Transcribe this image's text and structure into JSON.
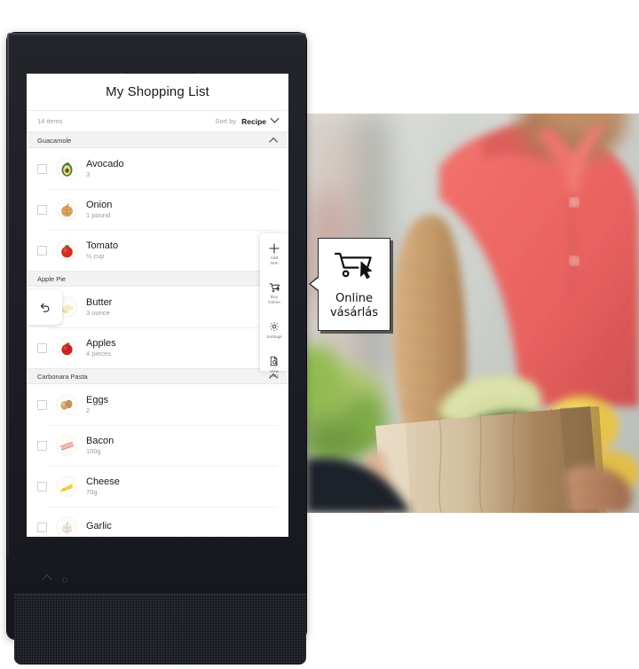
{
  "app": {
    "title": "My Shopping List",
    "item_count": "14 items",
    "sort_by_label": "Sort by",
    "sort_value": "Recipe",
    "sort_chevron_icon": "chevron-down-icon",
    "collapse_chevron_icon": "chevron-up-icon",
    "undo_icon": "undo-arrow-icon"
  },
  "groups": [
    {
      "name": "Guacamole",
      "items": [
        {
          "name": "Avocado",
          "qty": "3",
          "icon": "avocado-icon",
          "checked": false
        },
        {
          "name": "Onion",
          "qty": "1 pound",
          "icon": "onion-icon",
          "checked": false
        },
        {
          "name": "Tomato",
          "qty": "½ cup",
          "icon": "tomato-icon",
          "checked": false
        }
      ]
    },
    {
      "name": "Apple Pie",
      "items": [
        {
          "name": "Butter",
          "qty": "3 ounce",
          "icon": "butter-icon",
          "checked": false,
          "swiped": true
        },
        {
          "name": "Apples",
          "qty": "4 pieces",
          "icon": "apple-icon",
          "checked": false
        }
      ]
    },
    {
      "name": "Carbonara Pasta",
      "items": [
        {
          "name": "Eggs",
          "qty": "2",
          "icon": "eggs-icon",
          "checked": false
        },
        {
          "name": "Bacon",
          "qty": "100g",
          "icon": "bacon-icon",
          "checked": false
        },
        {
          "name": "Cheese",
          "qty": "70g",
          "icon": "cheese-icon",
          "checked": false
        },
        {
          "name": "Garlic",
          "qty": "",
          "icon": "garlic-icon",
          "checked": false
        }
      ]
    }
  ],
  "rail": [
    {
      "label": "Add\nItem",
      "icon": "plus-icon"
    },
    {
      "label": "Buy\nOnline",
      "icon": "shopping-cart-cursor-icon"
    },
    {
      "label": "Settings",
      "icon": "gear-icon"
    },
    {
      "label": "View\nLists",
      "icon": "document-search-icon"
    }
  ],
  "callout": {
    "text": "Online\nvásárlás",
    "icon": "cart-cursor-icon"
  },
  "photo": {
    "alt": "delivery-person-holding-grocery-bag"
  },
  "colors": {
    "device_body": "#1c1e24",
    "screen_bg": "#ffffff",
    "group_header_bg": "#f2f2f2",
    "shirt_red": "#e8625f",
    "bag_brown": "#c2a077"
  }
}
